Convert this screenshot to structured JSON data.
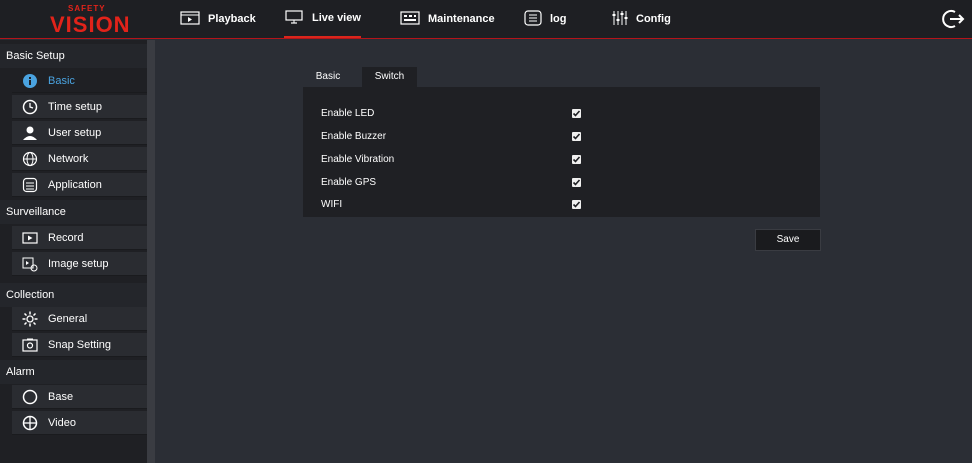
{
  "logo": {
    "top_text": "SAFETY",
    "main_text": "VISION"
  },
  "nav": [
    {
      "label": "Playback",
      "icon": "playback-icon"
    },
    {
      "label": "Live view",
      "icon": "monitor-icon"
    },
    {
      "label": "Maintenance",
      "icon": "maintenance-icon"
    },
    {
      "label": "log",
      "icon": "log-icon"
    },
    {
      "label": "Config",
      "icon": "config-icon"
    }
  ],
  "active_nav": "Live view",
  "sidebar": {
    "sections": [
      {
        "title": "Basic Setup",
        "items": [
          "Basic",
          "Time setup",
          "User setup",
          "Network",
          "Application"
        ]
      },
      {
        "title": "Surveillance",
        "items": [
          "Record",
          "Image setup"
        ]
      },
      {
        "title": "Collection",
        "items": [
          "General",
          "Snap Setting"
        ]
      },
      {
        "title": "Alarm",
        "items": [
          "Base",
          "Video"
        ]
      }
    ],
    "active_item": "Basic"
  },
  "tabs": [
    "Basic",
    "Switch"
  ],
  "active_tab": "Switch",
  "switches": [
    {
      "label": "Enable LED",
      "checked": true
    },
    {
      "label": "Enable Buzzer",
      "checked": true
    },
    {
      "label": "Enable Vibration",
      "checked": true
    },
    {
      "label": "Enable GPS",
      "checked": true
    },
    {
      "label": "WIFI",
      "checked": true
    }
  ],
  "save_label": "Save",
  "colors": {
    "accent": "#d9261c",
    "active_blue": "#4aa3e0",
    "brand_red": "#e2231a"
  }
}
